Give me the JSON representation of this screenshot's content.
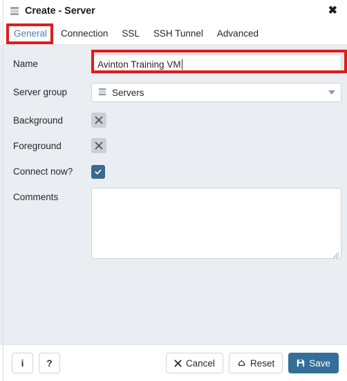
{
  "titlebar": {
    "icon": "server-icon",
    "title": "Create - Server",
    "close_label": "✖"
  },
  "tabs": [
    {
      "label": "General",
      "active": true
    },
    {
      "label": "Connection",
      "active": false
    },
    {
      "label": "SSL",
      "active": false
    },
    {
      "label": "SSH Tunnel",
      "active": false
    },
    {
      "label": "Advanced",
      "active": false
    }
  ],
  "form": {
    "name": {
      "label": "Name",
      "value": "Avinton Training VM",
      "placeholder": ""
    },
    "server_group": {
      "label": "Server group",
      "value": "Servers",
      "icon": "server-icon",
      "options": [
        "Servers"
      ]
    },
    "background": {
      "label": "Background",
      "icon": "x-icon",
      "value": ""
    },
    "foreground": {
      "label": "Foreground",
      "icon": "x-icon",
      "value": ""
    },
    "connect_now": {
      "label": "Connect now?",
      "checked": true
    },
    "comments": {
      "label": "Comments",
      "value": "",
      "placeholder": ""
    }
  },
  "footer": {
    "info_label": "i",
    "help_label": "?",
    "cancel_label": "Cancel",
    "reset_label": "Reset",
    "save_label": "Save"
  },
  "annotations": {
    "tab_highlight": "General",
    "field_highlight": "Name",
    "color": "#e01b1b"
  },
  "colors": {
    "accent": "#336f98",
    "tab_active": "#4a7fae",
    "form_bg": "#eaedf2",
    "checkbox": "#3b6a8f",
    "annotation": "#e01b1b"
  }
}
